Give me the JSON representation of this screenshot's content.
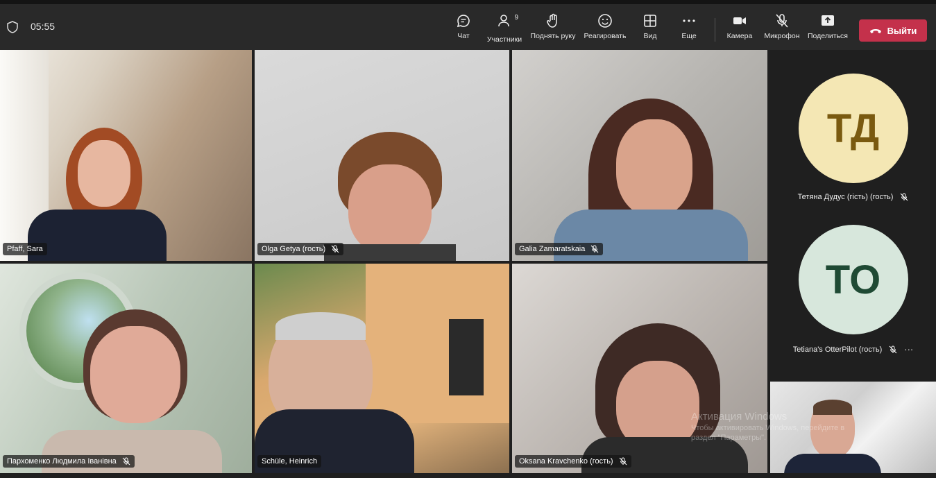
{
  "header": {
    "timer": "05:55",
    "tools": {
      "chat": "Чат",
      "participants": "Участники",
      "participants_count": "9",
      "raise_hand": "Поднять руку",
      "react": "Реагировать",
      "view": "Вид",
      "more": "Еще",
      "camera": "Камера",
      "microphone": "Микрофон",
      "share": "Поделиться"
    },
    "leave_label": "Выйти"
  },
  "participants": [
    {
      "name": "Pfaff, Sara"
    },
    {
      "name": "Olga Getya (гость)"
    },
    {
      "name": "Galia Zamaratskaia"
    },
    {
      "name": "Пархоменко Людмила Іванівна"
    },
    {
      "name": "Schüle, Heinrich"
    },
    {
      "name": "Oksana Kravchenko (гость)"
    }
  ],
  "sidebar": [
    {
      "initials": "ТД",
      "name": "Тетяна Дудус (гість) (гость)"
    },
    {
      "initials": "TO",
      "name": "Tetiana's OtterPilot (гость)",
      "more": "···"
    }
  ],
  "watermark": {
    "title": "Активация Windows",
    "line1": "Чтобы активировать Windows, перейдите в",
    "line2": "раздел \"Параметры\"."
  },
  "colors": {
    "leave": "#c4314b",
    "avatar_td_bg": "#f4e7b4",
    "avatar_td_fg": "#7a5a10",
    "avatar_to_bg": "#d7e7dc",
    "avatar_to_fg": "#1f4a34"
  }
}
